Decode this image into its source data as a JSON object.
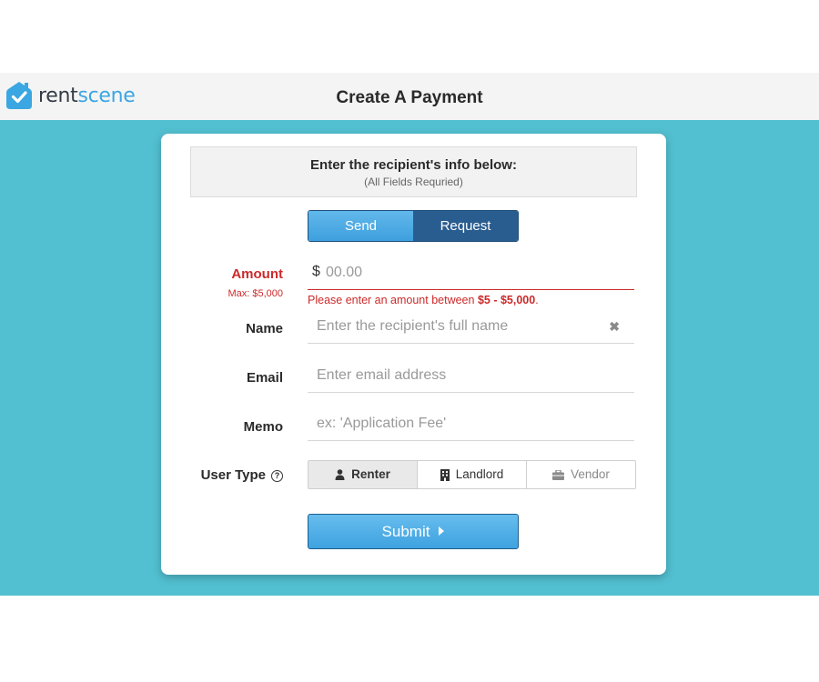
{
  "header": {
    "logo_rent": "rent",
    "logo_scene": "scene",
    "title": "Create A Payment"
  },
  "info": {
    "title": "Enter the recipient's info below:",
    "subtitle": "(All Fields Requried)"
  },
  "toggle": {
    "send_label": "Send",
    "request_label": "Request",
    "selected": "Request"
  },
  "form": {
    "amount": {
      "label": "Amount",
      "sublabel": "Max: $5,000",
      "currency": "$",
      "placeholder": "00.00",
      "error_prefix": "Please enter an amount between ",
      "error_range": "$5 - $5,000",
      "error_suffix": "."
    },
    "name": {
      "label": "Name",
      "placeholder": "Enter the recipient's full name",
      "clear_icon": "✖"
    },
    "email": {
      "label": "Email",
      "placeholder": "Enter email address"
    },
    "memo": {
      "label": "Memo",
      "placeholder": "ex: 'Application Fee'"
    },
    "user_type": {
      "label": "User Type",
      "help_icon": "?",
      "options": [
        {
          "label": "Renter",
          "icon": "person-icon"
        },
        {
          "label": "Landlord",
          "icon": "building-icon"
        },
        {
          "label": "Vendor",
          "icon": "briefcase-icon"
        }
      ],
      "selected": "Renter"
    },
    "submit_label": "Submit"
  },
  "colors": {
    "brand_dark": "#333b46",
    "brand_blue": "#3aa6e2",
    "teal_background": "#52c0d1",
    "error_red": "#cc2a2a",
    "toggle_dark": "#2a5d8f"
  }
}
